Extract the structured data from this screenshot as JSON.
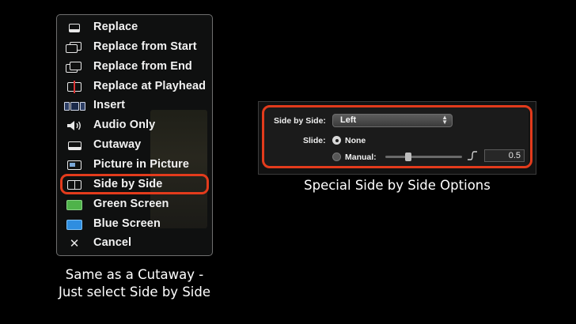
{
  "menu": {
    "items": [
      {
        "label": "Replace",
        "icon": "replace-icon"
      },
      {
        "label": "Replace from Start",
        "icon": "replace-from-start-icon"
      },
      {
        "label": "Replace from End",
        "icon": "replace-from-end-icon"
      },
      {
        "label": "Replace at Playhead",
        "icon": "replace-at-playhead-icon"
      },
      {
        "label": "Insert",
        "icon": "insert-icon"
      },
      {
        "label": "Audio Only",
        "icon": "speaker-icon"
      },
      {
        "label": "Cutaway",
        "icon": "cutaway-icon"
      },
      {
        "label": "Picture in Picture",
        "icon": "picture-in-picture-icon"
      },
      {
        "label": "Side by Side",
        "icon": "side-by-side-icon"
      },
      {
        "label": "Green Screen",
        "icon": "green-screen-icon"
      },
      {
        "label": "Blue Screen",
        "icon": "blue-screen-icon"
      },
      {
        "label": "Cancel",
        "icon": "close-icon"
      }
    ],
    "highlighted": "Side by Side"
  },
  "caption_left": "Same as a Cutaway - Just select Side by Side",
  "options_panel": {
    "side_by_side_label": "Side by Side:",
    "side_by_side_value": "Left",
    "slide_label": "Slide:",
    "none_label": "None",
    "manual_label": "Manual:",
    "selected_option": "None",
    "manual_value": "0.5",
    "slider_fraction": 0.28
  },
  "caption_right": "Special Side by Side Options",
  "colors": {
    "highlight_ring": "#e33b1c",
    "background": "#000000"
  }
}
